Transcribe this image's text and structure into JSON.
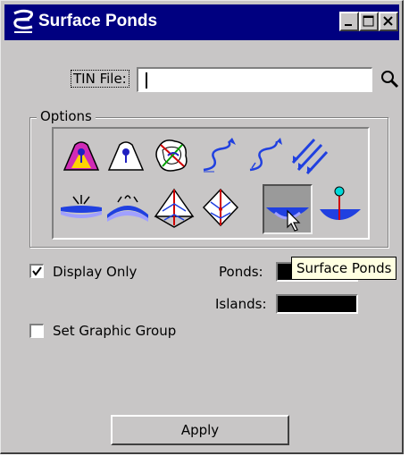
{
  "window": {
    "title": "Surface Ponds",
    "title_icon": "inroads-logo-icon",
    "controls": [
      "minimize",
      "maximize",
      "close"
    ]
  },
  "tin": {
    "label": "TIN File:",
    "value": "",
    "search_icon": "magnifier-search-icon"
  },
  "options": {
    "legend": "Options",
    "tools": [
      {
        "name": "tool-volcano-colored",
        "icon": "volcano-colored-icon",
        "active": false
      },
      {
        "name": "tool-volcano",
        "icon": "volcano-icon",
        "active": false
      },
      {
        "name": "tool-contour-blob",
        "icon": "contour-blob-icon",
        "active": false
      },
      {
        "name": "tool-flow-arrow",
        "icon": "flow-arrow-icon",
        "active": false
      },
      {
        "name": "tool-flow-arrow-2",
        "icon": "flow-arrow-dashed-icon",
        "active": false
      },
      {
        "name": "tool-multi-arrows",
        "icon": "multi-flow-arrows-icon",
        "active": false
      },
      {
        "name": "tool-low-point",
        "icon": "low-point-icon",
        "active": false
      },
      {
        "name": "tool-high-point",
        "icon": "high-point-icon",
        "active": false
      },
      {
        "name": "tool-watershed",
        "icon": "watershed-icon",
        "active": false
      },
      {
        "name": "tool-watershed-2",
        "icon": "watershed-diamond-icon",
        "active": false
      },
      {
        "name": "tool-surface-ponds",
        "icon": "surface-ponds-icon",
        "active": true
      },
      {
        "name": "tool-pond-marker",
        "icon": "pond-marker-icon",
        "active": false
      }
    ]
  },
  "display_only": {
    "label": "Display Only",
    "checked": true
  },
  "ponds": {
    "label": "Ponds:",
    "color": "#000000"
  },
  "islands": {
    "label": "Islands:",
    "color": "#000000"
  },
  "set_graphic_group": {
    "label": "Set Graphic Group",
    "checked": false
  },
  "tooltip": {
    "text": "Surface Ponds"
  },
  "apply": {
    "label": "Apply"
  }
}
